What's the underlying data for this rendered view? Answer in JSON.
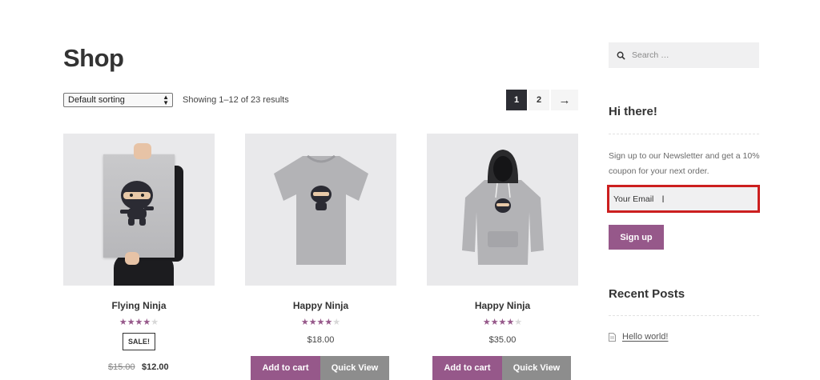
{
  "page": {
    "title": "Shop"
  },
  "toolbar": {
    "sort_selected": "Default sorting",
    "result_count": "Showing 1–12 of 23 results"
  },
  "pagination": {
    "pages": [
      "1",
      "2"
    ],
    "current": "1",
    "next": "→"
  },
  "products": [
    {
      "name": "Flying Ninja",
      "rating": 4,
      "badge": "SALE!",
      "old_price": "$15.00",
      "price": "$12.00"
    },
    {
      "name": "Happy Ninja",
      "rating": 4.5,
      "price": "$18.00",
      "add_to_cart": "Add to cart",
      "quick_view": "Quick View"
    },
    {
      "name": "Happy Ninja",
      "rating": 4,
      "price": "$35.00",
      "add_to_cart": "Add to cart",
      "quick_view": "Quick View"
    }
  ],
  "sidebar": {
    "search": {
      "placeholder": "Search …"
    },
    "newsletter": {
      "title": "Hi there!",
      "text": "Sign up to our Newsletter and get a 10% coupon for your next order.",
      "email_placeholder": "Your Email",
      "signup_label": "Sign up"
    },
    "recent_posts": {
      "title": "Recent Posts",
      "items": [
        "Hello world!"
      ]
    }
  },
  "colors": {
    "accent": "#96588a",
    "highlight_border": "#cc1f1f",
    "quick_view": "#8d8d8d"
  }
}
